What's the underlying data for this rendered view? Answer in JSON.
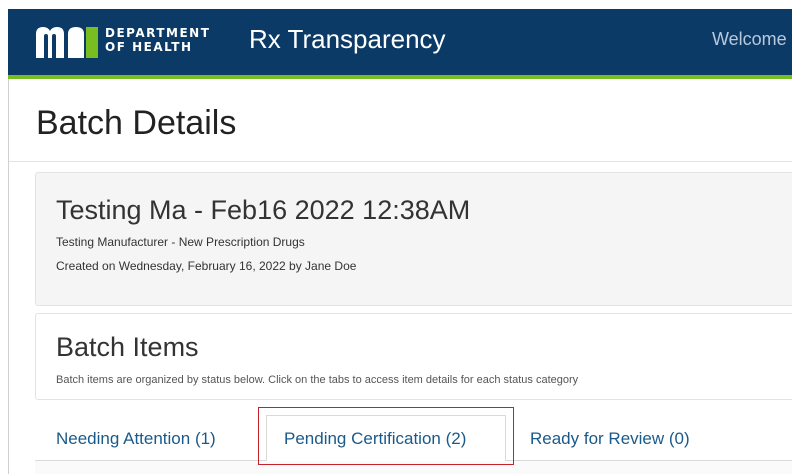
{
  "header": {
    "logo_icon": "mn-logo-icon",
    "dept_line1": "DEPARTMENT",
    "dept_line2": "OF HEALTH",
    "app_title": "Rx Transparency",
    "welcome_text": "Welcome"
  },
  "page": {
    "title": "Batch Details"
  },
  "batch": {
    "name": "Testing Ma - Feb16 2022 12:38AM",
    "subtitle": "Testing Manufacturer - New Prescription Drugs",
    "created": "Created on Wednesday, February 16, 2022 by Jane Doe"
  },
  "batch_items": {
    "title": "Batch Items",
    "description": "Batch items are organized by status below. Click on the tabs to access item details for each status category"
  },
  "tabs": [
    {
      "label": "Needing Attention (1)",
      "active": false
    },
    {
      "label": "Pending Certification (2)",
      "active": true
    },
    {
      "label": "Ready for Review (0)",
      "active": false
    }
  ],
  "colors": {
    "header_bg": "#0b3a66",
    "accent_green": "#78be20",
    "highlight_red": "#c8202a",
    "link_blue": "#1a5a8a"
  }
}
